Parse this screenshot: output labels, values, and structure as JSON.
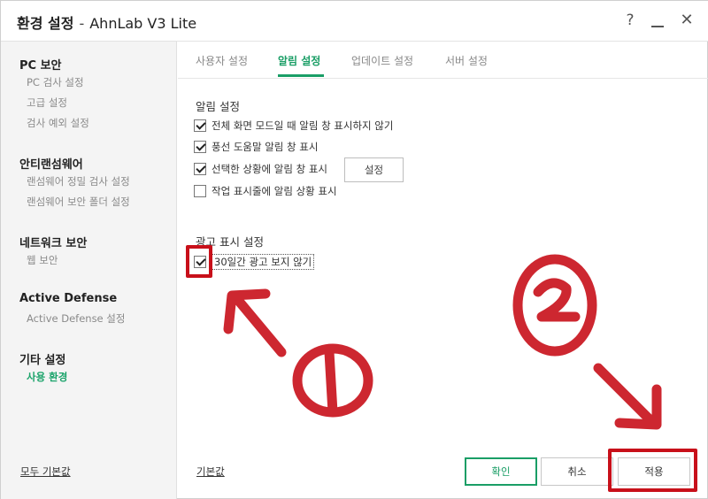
{
  "window": {
    "title_bold": "환경 설정",
    "title_sep": "-",
    "title_app": "AhnLab V3 Lite",
    "help": "?",
    "minimize": "",
    "close": "✕"
  },
  "sidebar": {
    "groups": [
      {
        "label": "PC 보안",
        "items": [
          "PC 검사 설정",
          "고급 설정",
          "검사 예외 설정"
        ]
      },
      {
        "label": "안티랜섬웨어",
        "items": [
          "랜섬웨어 정밀 검사 설정",
          "랜섬웨어 보안 폴더 설정"
        ]
      },
      {
        "label": "네트워크 보안",
        "items": [
          "웹 보안"
        ]
      },
      {
        "label": "Active Defense",
        "items": [
          "Active Defense 설정"
        ]
      },
      {
        "label": "기타 설정",
        "items": [
          "사용 환경"
        ]
      }
    ],
    "reset_all": "모두 기본값"
  },
  "tabs": [
    "사용자 설정",
    "알림 설정",
    "업데이트 설정",
    "서버 설정"
  ],
  "notification": {
    "title": "알림 설정",
    "options": [
      {
        "label": "전체 화면 모드일 때 알림 창 표시하지 않기",
        "checked": true
      },
      {
        "label": "풍선 도움말 알림 창 표시",
        "checked": true
      },
      {
        "label": "선택한 상황에 알림 창 표시",
        "checked": true
      },
      {
        "label": "작업 표시줄에 알림 상황 표시",
        "checked": false
      }
    ],
    "settings_button": "설정"
  },
  "ads": {
    "title": "광고 표시 설정",
    "option": {
      "label": "30일간 광고 보지 않기",
      "checked": true
    }
  },
  "footer": {
    "default": "기본값",
    "ok": "확인",
    "cancel": "취소",
    "apply": "적용"
  },
  "annotation": {
    "color": "#c8101a"
  }
}
